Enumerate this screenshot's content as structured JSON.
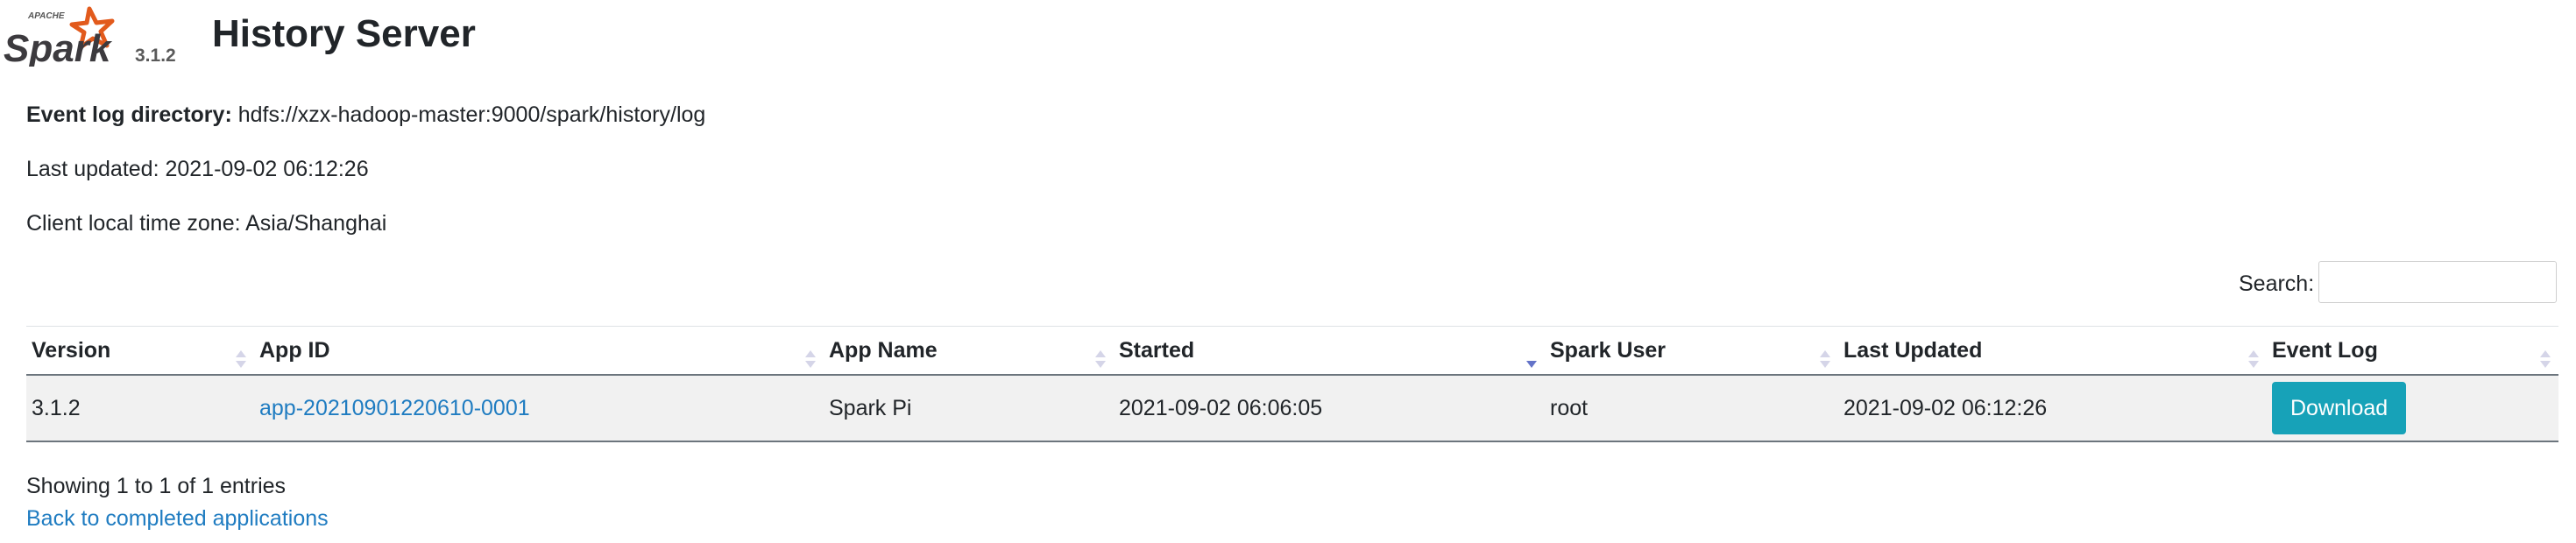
{
  "header": {
    "logo_top_text": "APACHE",
    "logo_text": "Spark",
    "version": "3.1.2",
    "title": "History Server"
  },
  "info": {
    "event_log_label": "Event log directory:",
    "event_log_value": "hdfs://xzx-hadoop-master:9000/spark/history/log",
    "last_updated": "Last updated: 2021-09-02 06:12:26",
    "time_zone": "Client local time zone: Asia/Shanghai"
  },
  "search": {
    "label": "Search:",
    "value": ""
  },
  "table": {
    "columns": [
      "Version",
      "App ID",
      "App Name",
      "Started",
      "Spark User",
      "Last Updated",
      "Event Log"
    ],
    "rows": [
      {
        "version": "3.1.2",
        "app_id": "app-20210901220610-0001",
        "app_name": "Spark Pi",
        "started": "2021-09-02 06:06:05",
        "spark_user": "root",
        "last_updated": "2021-09-02 06:12:26",
        "event_log": "Download"
      }
    ]
  },
  "footer": {
    "showing": "Showing 1 to 1 of 1 entries",
    "back_link": "Back to completed applications"
  },
  "colors": {
    "accent_button": "#17a2b8",
    "link": "#1f7cc1",
    "logo_orange": "#e25a1c",
    "row_bg": "#f1f1f1"
  },
  "icons": {
    "sort": "sort-both-icon",
    "sort_active": "sort-desc-icon"
  }
}
